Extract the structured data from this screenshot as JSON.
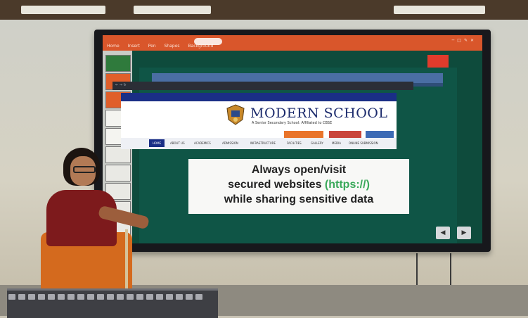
{
  "slide_app": {
    "menus": [
      "Home",
      "Insert",
      "Pen",
      "Shapes",
      "Background"
    ],
    "window_controls": [
      "minimize-icon",
      "restore-icon",
      "edit-icon",
      "close-icon"
    ]
  },
  "website": {
    "school_name": "MODERN SCHOOL",
    "school_subtitle": "A Senior Secondary School: Affiliated to CBSE",
    "buttons": [
      "",
      "",
      ""
    ],
    "nav_items": [
      "HOME",
      "ABOUT US",
      "ACADEMICS",
      "ADMISSION",
      "INFRASTRUCTURE",
      "FACILITIES",
      "GALLERY",
      "MEDIA",
      "ONLINE SUBMISSION"
    ]
  },
  "slide_message": {
    "line1": "Always open/visit",
    "line2_prefix": "secured websites ",
    "line2_https": "(https://)",
    "line3": "while sharing sensitive data"
  },
  "navigation": {
    "prev_icon": "arrow-left-icon",
    "next_icon": "arrow-right-icon"
  },
  "colors": {
    "ppt_bar": "#d9562b",
    "slide_bg": "#0f5546",
    "school_title": "#1b2a6c",
    "https_green": "#3aa95a",
    "saree": "#d46a1e",
    "blouse": "#7d1a1c"
  }
}
